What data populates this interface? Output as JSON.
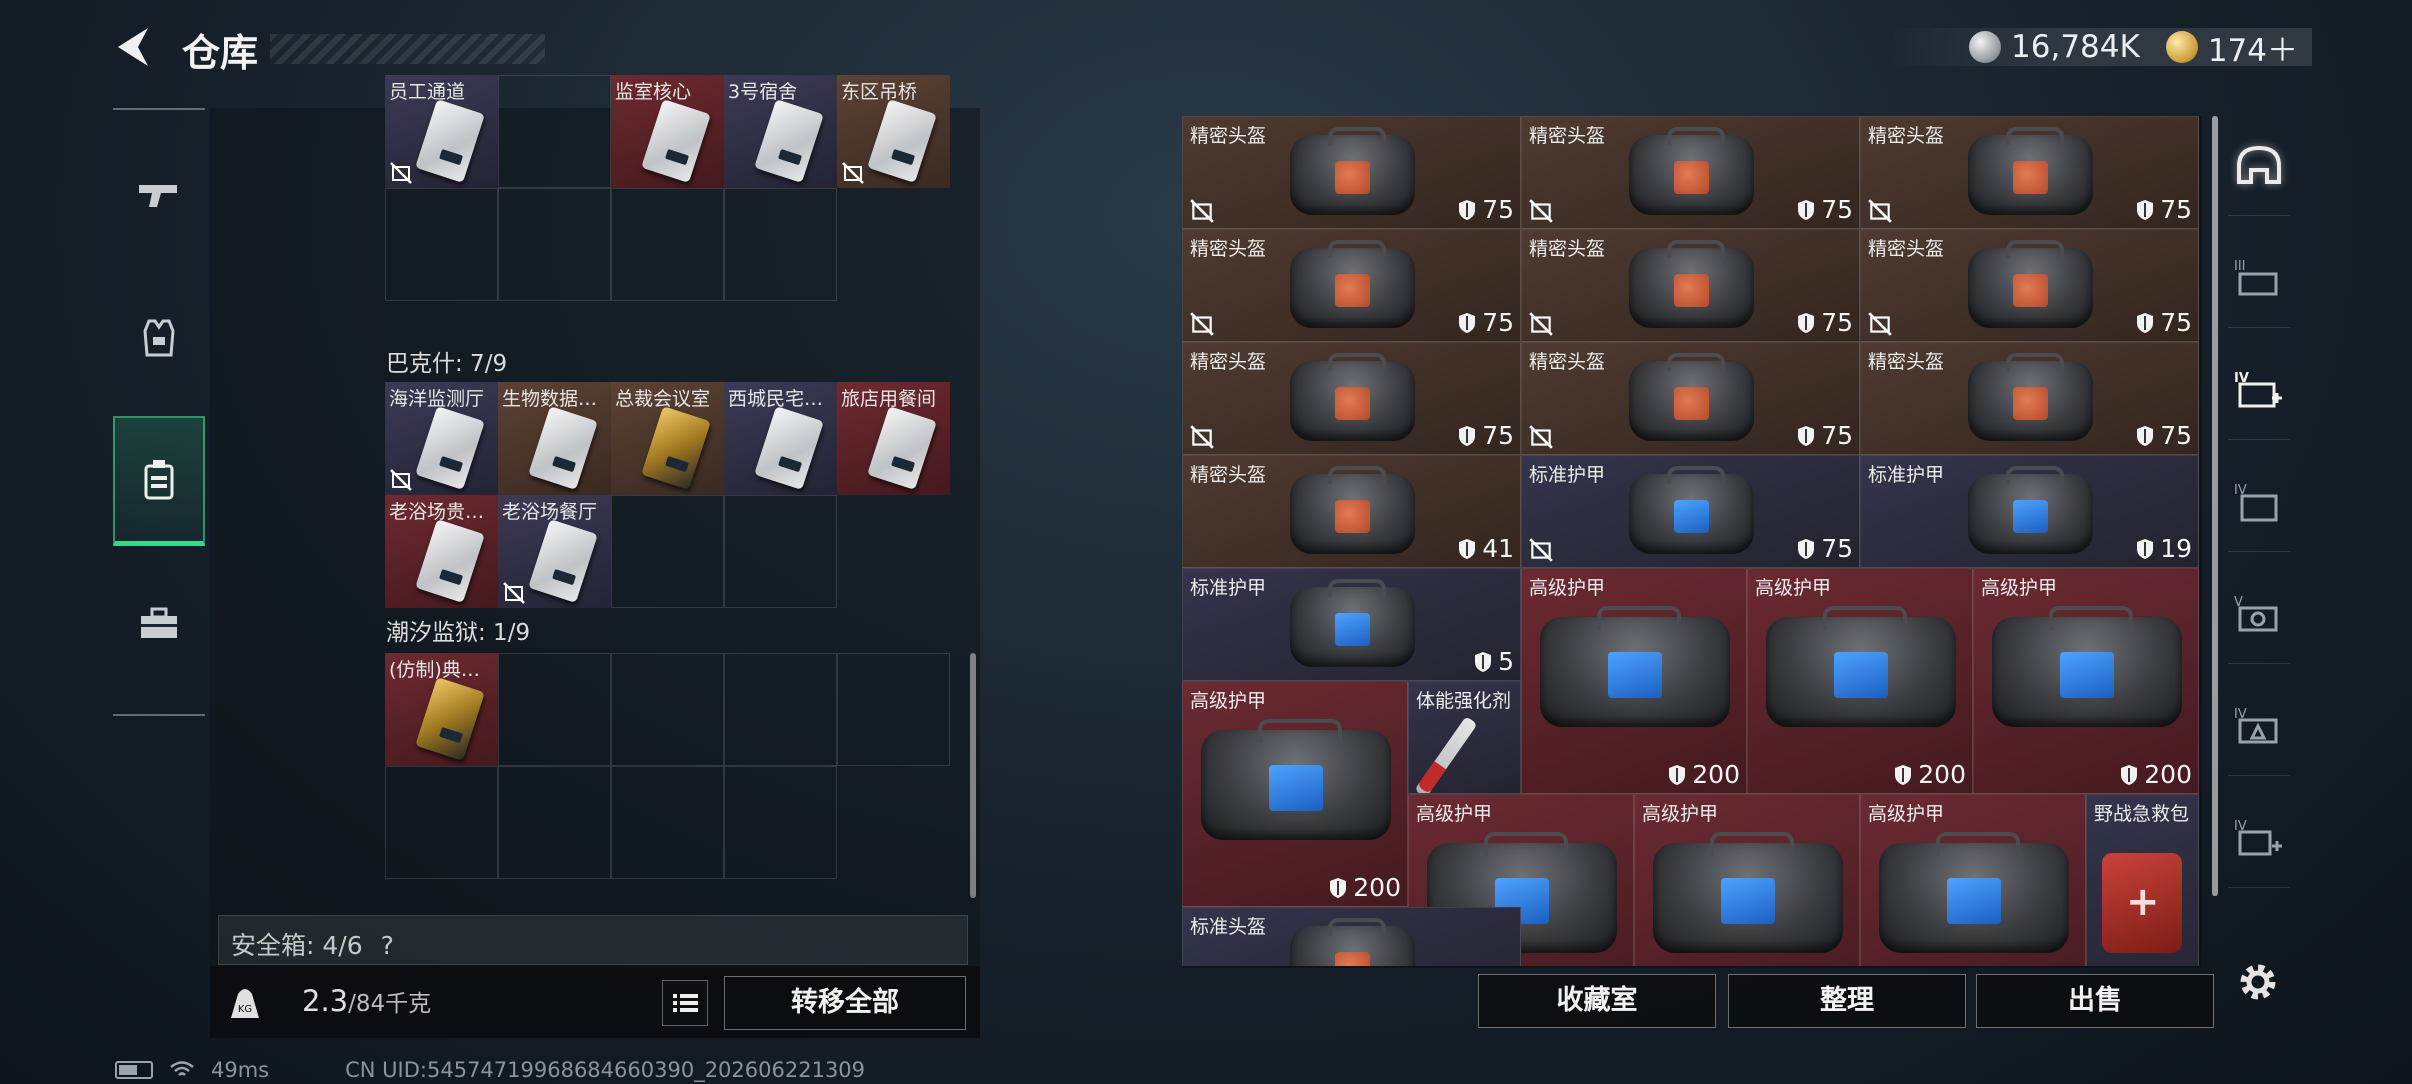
{
  "header": {
    "title": "仓库",
    "currencies": [
      {
        "icon": "silver-coin-icon",
        "value": "16,784K"
      },
      {
        "icon": "gold-coin-icon",
        "value": "174＋"
      }
    ]
  },
  "categories": [
    {
      "icon": "pistol-icon",
      "active": false
    },
    {
      "icon": "armor-vest-icon",
      "active": false
    },
    {
      "icon": "keycard-holder-icon",
      "active": true
    },
    {
      "icon": "toolbox-icon",
      "active": false
    }
  ],
  "left": {
    "sections": [
      {
        "title": "",
        "cards": [
          {
            "label": "员工通道",
            "color": "blue",
            "gold": false,
            "notrade": true
          },
          {
            "label": "",
            "color": "",
            "gold": false,
            "notrade": false
          },
          {
            "label": "监室核心",
            "color": "red",
            "gold": false,
            "notrade": false
          },
          {
            "label": "3号宿舍",
            "color": "blue",
            "gold": false,
            "notrade": false
          },
          {
            "label": "东区吊桥",
            "color": "brown",
            "gold": false,
            "notrade": true
          }
        ]
      },
      {
        "title": "巴克什: 7/9",
        "cards": [
          {
            "label": "海洋监测厅",
            "color": "blue",
            "gold": false,
            "notrade": true
          },
          {
            "label": "生物数据…",
            "color": "brown",
            "gold": false,
            "notrade": false
          },
          {
            "label": "总裁会议室",
            "color": "brown",
            "gold": true,
            "notrade": false
          },
          {
            "label": "西城民宅…",
            "color": "blue",
            "gold": false,
            "notrade": false
          },
          {
            "label": "旅店用餐间",
            "color": "red",
            "gold": false,
            "notrade": false
          },
          {
            "label": "老浴场贵…",
            "color": "red",
            "gold": false,
            "notrade": false
          },
          {
            "label": "老浴场餐厅",
            "color": "blue",
            "gold": false,
            "notrade": true
          }
        ]
      },
      {
        "title": "潮汐监狱: 1/9",
        "cards": [
          {
            "label": "(仿制)典…",
            "color": "red",
            "gold": true,
            "notrade": false
          }
        ]
      }
    ],
    "safe_box": {
      "label": "安全箱: 4/6",
      "help": "?"
    },
    "weight": {
      "current": "2.3",
      "max": "/84千克"
    },
    "transfer_label": "转移全部"
  },
  "right": {
    "items": [
      {
        "label": "精密头盔",
        "dur": "75",
        "color": "brown",
        "patch": "orange",
        "notrade": true
      },
      {
        "label": "精密头盔",
        "dur": "75",
        "color": "brown",
        "patch": "orange",
        "notrade": true
      },
      {
        "label": "精密头盔",
        "dur": "75",
        "color": "brown",
        "patch": "orange",
        "notrade": true
      },
      {
        "label": "精密头盔",
        "dur": "75",
        "color": "brown",
        "patch": "orange",
        "notrade": true
      },
      {
        "label": "精密头盔",
        "dur": "75",
        "color": "brown",
        "patch": "orange",
        "notrade": true
      },
      {
        "label": "精密头盔",
        "dur": "75",
        "color": "brown",
        "patch": "orange",
        "notrade": true
      },
      {
        "label": "精密头盔",
        "dur": "75",
        "color": "brown",
        "patch": "orange",
        "notrade": true
      },
      {
        "label": "精密头盔",
        "dur": "75",
        "color": "brown",
        "patch": "orange",
        "notrade": true
      },
      {
        "label": "精密头盔",
        "dur": "75",
        "color": "brown",
        "patch": "orange",
        "notrade": false
      },
      {
        "label": "精密头盔",
        "dur": "41",
        "color": "brown",
        "patch": "orange",
        "notrade": false
      },
      {
        "label": "标准护甲",
        "dur": "75",
        "color": "blue",
        "patch": "blue",
        "notrade": true
      },
      {
        "label": "标准护甲",
        "dur": "19",
        "color": "blue",
        "patch": "blue",
        "notrade": false
      },
      {
        "label": "标准护甲",
        "dur": "5",
        "color": "blue",
        "patch": "blue",
        "notrade": false
      },
      {
        "label": "高级护甲",
        "dur": "200",
        "color": "red",
        "patch": "blue",
        "notrade": false
      },
      {
        "label": "高级护甲",
        "dur": "200",
        "color": "red",
        "patch": "blue",
        "notrade": false
      },
      {
        "label": "高级护甲",
        "dur": "200",
        "color": "red",
        "patch": "blue",
        "notrade": false
      },
      {
        "label": "高级护甲",
        "dur": "200",
        "color": "red",
        "patch": "blue",
        "notrade": false
      },
      {
        "label": "体能强化剂",
        "dur": "",
        "color": "blue",
        "patch": "syringe",
        "notrade": false
      },
      {
        "label": "高级护甲",
        "dur": "",
        "color": "red",
        "patch": "blue",
        "notrade": false
      },
      {
        "label": "高级护甲",
        "dur": "",
        "color": "red",
        "patch": "blue",
        "notrade": false
      },
      {
        "label": "高级护甲",
        "dur": "",
        "color": "red",
        "patch": "blue",
        "notrade": false
      },
      {
        "label": "野战急救包",
        "dur": "",
        "color": "blue",
        "patch": "medkit",
        "notrade": false
      },
      {
        "label": "标准头盔",
        "dur": "",
        "color": "blue",
        "patch": "orange",
        "notrade": false
      }
    ],
    "actions": {
      "collection": "收藏室",
      "organize": "整理",
      "sell": "出售"
    }
  },
  "tabs": [
    {
      "icon": "helmet-icon",
      "badge": ""
    },
    {
      "icon": "armor-tier3-icon",
      "badge": "III"
    },
    {
      "icon": "medkit-tier4-icon",
      "badge": "IV"
    },
    {
      "icon": "locker-tier4-icon",
      "badge": "IV"
    },
    {
      "icon": "camera-tier5-icon",
      "badge": "V"
    },
    {
      "icon": "vest-tier4-icon",
      "badge": "IV"
    },
    {
      "icon": "medkit-plus-tier4-icon",
      "badge": "IV"
    }
  ],
  "status": {
    "ping": "49ms",
    "uid": "CN UID:545747199686846603​90_202606221309"
  }
}
